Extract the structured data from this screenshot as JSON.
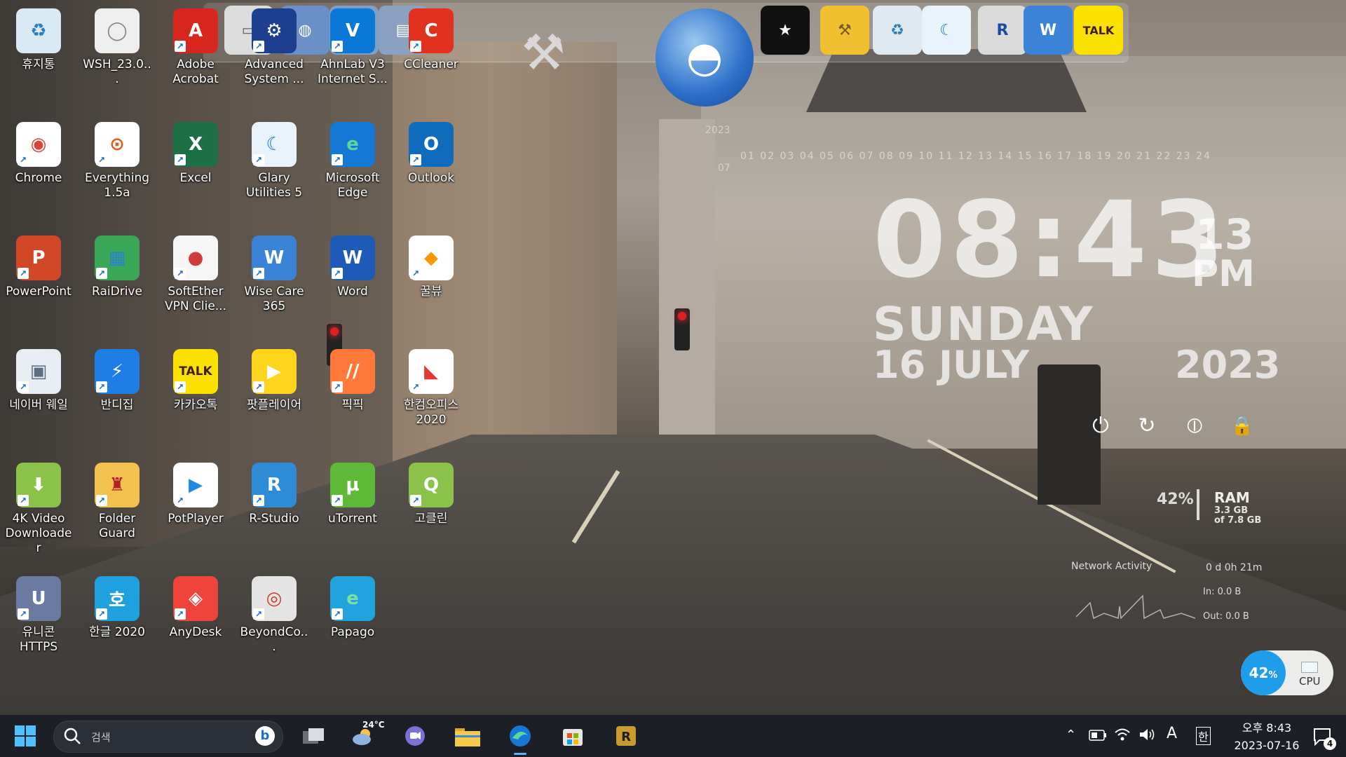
{
  "desktop_icons": [
    {
      "id": "recycle",
      "label": "휴지통",
      "color": "#d9eaf5",
      "glyph": "♻",
      "fg": "#2a7fc1"
    },
    {
      "id": "chrome",
      "label": "Chrome",
      "color": "#ffffff",
      "glyph": "◉",
      "fg": "#db4437"
    },
    {
      "id": "powerpoint",
      "label": "PowerPoint",
      "color": "#d24726",
      "glyph": "P",
      "fg": "#ffffff"
    },
    {
      "id": "naver-whale",
      "label": "네이버 웨일",
      "color": "#e8eef4",
      "glyph": "▣",
      "fg": "#5a6f86"
    },
    {
      "id": "4k-video",
      "label": "4K Video Downloader",
      "color": "#8bc34a",
      "glyph": "⬇",
      "fg": "#ffffff"
    },
    {
      "id": "unicorn",
      "label": "유니콘 HTTPS",
      "color": "#6a7aa0",
      "glyph": "U",
      "fg": "#ffffff"
    },
    {
      "id": "wsh",
      "label": "WSH_23.0...",
      "color": "#eeeeee",
      "glyph": "◯",
      "fg": "#888888"
    },
    {
      "id": "everything",
      "label": "Everything 1.5a",
      "color": "#ffffff",
      "glyph": "⊙",
      "fg": "#e35b18"
    },
    {
      "id": "raidrive",
      "label": "RaiDrive",
      "color": "#3aa757",
      "glyph": "▦",
      "fg": "#2c7fd1"
    },
    {
      "id": "bandizip",
      "label": "반디집",
      "color": "#1e7ee6",
      "glyph": "⚡",
      "fg": "#ffffff"
    },
    {
      "id": "folder-guard",
      "label": "Folder Guard",
      "color": "#f2c14e",
      "glyph": "♜",
      "fg": "#b3202a"
    },
    {
      "id": "hangul",
      "label": "한글 2020",
      "color": "#1fa1e0",
      "glyph": "호",
      "fg": "#ffffff"
    },
    {
      "id": "acrobat",
      "label": "Adobe Acrobat",
      "color": "#d7261e",
      "glyph": "A",
      "fg": "#ffffff"
    },
    {
      "id": "excel",
      "label": "Excel",
      "color": "#1d7044",
      "glyph": "X",
      "fg": "#ffffff"
    },
    {
      "id": "softether",
      "label": "SoftEther VPN Clie...",
      "color": "#f6f6f6",
      "glyph": "●",
      "fg": "#d23b3b"
    },
    {
      "id": "kakaotalk",
      "label": "카카오톡",
      "color": "#fae100",
      "glyph": "TALK",
      "fg": "#3c1e1e"
    },
    {
      "id": "potplayer",
      "label": "PotPlayer",
      "color": "#ffffff",
      "glyph": "▶",
      "fg": "#1e88e5"
    },
    {
      "id": "anydesk",
      "label": "AnyDesk",
      "color": "#ef443b",
      "glyph": "◈",
      "fg": "#ffffff"
    },
    {
      "id": "advanced-system",
      "label": "Advanced System ...",
      "color": "#1d3f8f",
      "glyph": "⚙",
      "fg": "#ffffff"
    },
    {
      "id": "glary",
      "label": "Glary Utilities 5",
      "color": "#e8f3fb",
      "glyph": "☾",
      "fg": "#1b76d2"
    },
    {
      "id": "wise-care",
      "label": "Wise Care 365",
      "color": "#3b83d6",
      "glyph": "W",
      "fg": "#ffffff"
    },
    {
      "id": "potplayer-kr",
      "label": "팟플레이어",
      "color": "#ffd41c",
      "glyph": "▶",
      "fg": "#ffffff"
    },
    {
      "id": "r-studio",
      "label": "R-Studio",
      "color": "#2e8bd6",
      "glyph": "R",
      "fg": "#ffffff"
    },
    {
      "id": "beyondcompare",
      "label": "BeyondCo...",
      "color": "#e4e4e4",
      "glyph": "◎",
      "fg": "#d13b2b"
    },
    {
      "id": "ahnlab",
      "label": "AhnLab V3 Internet S...",
      "color": "#0a78d6",
      "glyph": "V",
      "fg": "#ffffff"
    },
    {
      "id": "edge",
      "label": "Microsoft Edge",
      "color": "#1478d4",
      "glyph": "e",
      "fg": "#5fd3a0"
    },
    {
      "id": "word",
      "label": "Word",
      "color": "#1e5bb8",
      "glyph": "W",
      "fg": "#ffffff"
    },
    {
      "id": "picpick",
      "label": "픽픽",
      "color": "#ff7a3a",
      "glyph": "//",
      "fg": "#ffffff"
    },
    {
      "id": "utorrent",
      "label": "uTorrent",
      "color": "#5fb938",
      "glyph": "µ",
      "fg": "#ffffff"
    },
    {
      "id": "papago",
      "label": "Papago",
      "color": "#21a4de",
      "glyph": "e",
      "fg": "#7be0a5"
    },
    {
      "id": "ccleaner",
      "label": "CCleaner",
      "color": "#e0321f",
      "glyph": "C",
      "fg": "#ffffff"
    },
    {
      "id": "outlook",
      "label": "Outlook",
      "color": "#0f6cbd",
      "glyph": "O",
      "fg": "#ffffff"
    },
    {
      "id": "kkulview",
      "label": "꿀뷰",
      "color": "#ffffff",
      "glyph": "◆",
      "fg": "#ff9800"
    },
    {
      "id": "hancom-office",
      "label": "한컴오피스 2020",
      "color": "#ffffff",
      "glyph": "◣",
      "fg": "#e53935"
    },
    {
      "id": "gokollin",
      "label": "고클린",
      "color": "#8bc34a",
      "glyph": "Q",
      "fg": "#ffffff"
    }
  ],
  "dock_icons": [
    {
      "id": "dock-monitor",
      "glyph": "▭",
      "color": "#dcdcdc",
      "fg": "#666666"
    },
    {
      "id": "dock-network",
      "glyph": "◍",
      "color": "#6b8fc7",
      "fg": "#ffffff"
    },
    {
      "id": "dock-folder",
      "glyph": "📁",
      "color": "#7da0c4",
      "fg": "#ffffff"
    },
    {
      "id": "dock-folder2",
      "glyph": "▤",
      "color": "#8aa2c0",
      "fg": "#ffffff"
    },
    {
      "id": "dock-tools",
      "glyph": "⚒",
      "color": "#cfcfcf",
      "fg": "#555555"
    },
    {
      "id": "dock-globe",
      "glyph": "◓",
      "color": "#2a6fc9",
      "fg": "#ffffff"
    },
    {
      "id": "dock-tshirt",
      "glyph": "★",
      "color": "#111111",
      "fg": "#ffffff"
    },
    {
      "id": "dock-hammer",
      "glyph": "⚒",
      "color": "#f0c030",
      "fg": "#7a5a20"
    },
    {
      "id": "dock-recycle",
      "glyph": "♻",
      "color": "#dfe9f2",
      "fg": "#2a7fc1"
    },
    {
      "id": "dock-glary",
      "glyph": "☾",
      "color": "#e8f3fb",
      "fg": "#1b76d2"
    },
    {
      "id": "dock-rstudio",
      "glyph": "R",
      "color": "#dadada",
      "fg": "#1a4da0"
    },
    {
      "id": "dock-wise",
      "glyph": "W",
      "color": "#3b83d6",
      "fg": "#ffffff"
    },
    {
      "id": "dock-kakao",
      "glyph": "TALK",
      "color": "#fae100",
      "fg": "#3c1e1e"
    }
  ],
  "clock": {
    "time": "08:43",
    "seconds": "13",
    "ampm": "PM",
    "day": "SUNDAY",
    "date": "16 JULY",
    "year": "2023",
    "cal_year": "2023",
    "cal_month": "07",
    "cal_days": "01 02 03 04 05 06 07 08 09 10 11 12 13 14 15 16 17 18 19 20 21 22 23 24"
  },
  "power_buttons": [
    {
      "id": "power-icon",
      "glyph": "⏻"
    },
    {
      "id": "restart-icon",
      "glyph": "↻"
    },
    {
      "id": "sleep-icon",
      "glyph": "⦶"
    },
    {
      "id": "lock-icon",
      "glyph": "🔒"
    }
  ],
  "system": {
    "ram_percent": "42%",
    "ram_label": "RAM",
    "ram_used": "3.3 GB",
    "ram_total": "of 7.8 GB",
    "network_title": "Network Activity",
    "uptime": "0 d 0h 21m",
    "net_in": "In: 0.0 B",
    "net_out": "Out: 0.0 B",
    "cpu_percent": "42",
    "cpu_percent_sign": "%",
    "cpu_label": "CPU"
  },
  "taskbar": {
    "search_placeholder": "검색",
    "weather_temp": "24°C",
    "time": "오후 8:43",
    "date": "2023-07-16",
    "ime": "A",
    "ime_lang": "한",
    "notification_count": "4"
  },
  "colors": {
    "taskbar_bg": "#1c1f26",
    "accent": "#1e9de8"
  }
}
